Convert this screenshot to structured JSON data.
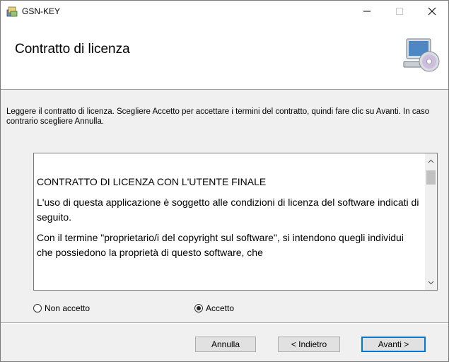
{
  "window": {
    "title": "GSN-KEY"
  },
  "header": {
    "title": "Contratto di licenza"
  },
  "instructions": "Leggere il contratto di licenza. Scegliere Accetto per accettare i termini del contratto, quindi fare clic su Avanti. In caso contrario scegliere Annulla.",
  "eula": {
    "paragraphs": [
      "CONTRATTO DI LICENZA CON L'UTENTE FINALE",
      "L'uso di questa applicazione è soggetto alle condizioni di licenza del software indicati di seguito.",
      "Con il termine \"proprietario/i del copyright sul software\", si intendono quegli individui che possiedono la proprietà di questo software, che"
    ]
  },
  "options": {
    "decline_label": "Non accetto",
    "accept_label": "Accetto",
    "selected": "accept"
  },
  "buttons": {
    "cancel": "Annulla",
    "back": "< Indietro",
    "next": "Avanti >"
  },
  "colors": {
    "accent": "#0078d7",
    "window_bg": "#f0f0f0"
  },
  "icons": {
    "app": "installer-package-icon",
    "header": "computer-cd-icon"
  }
}
